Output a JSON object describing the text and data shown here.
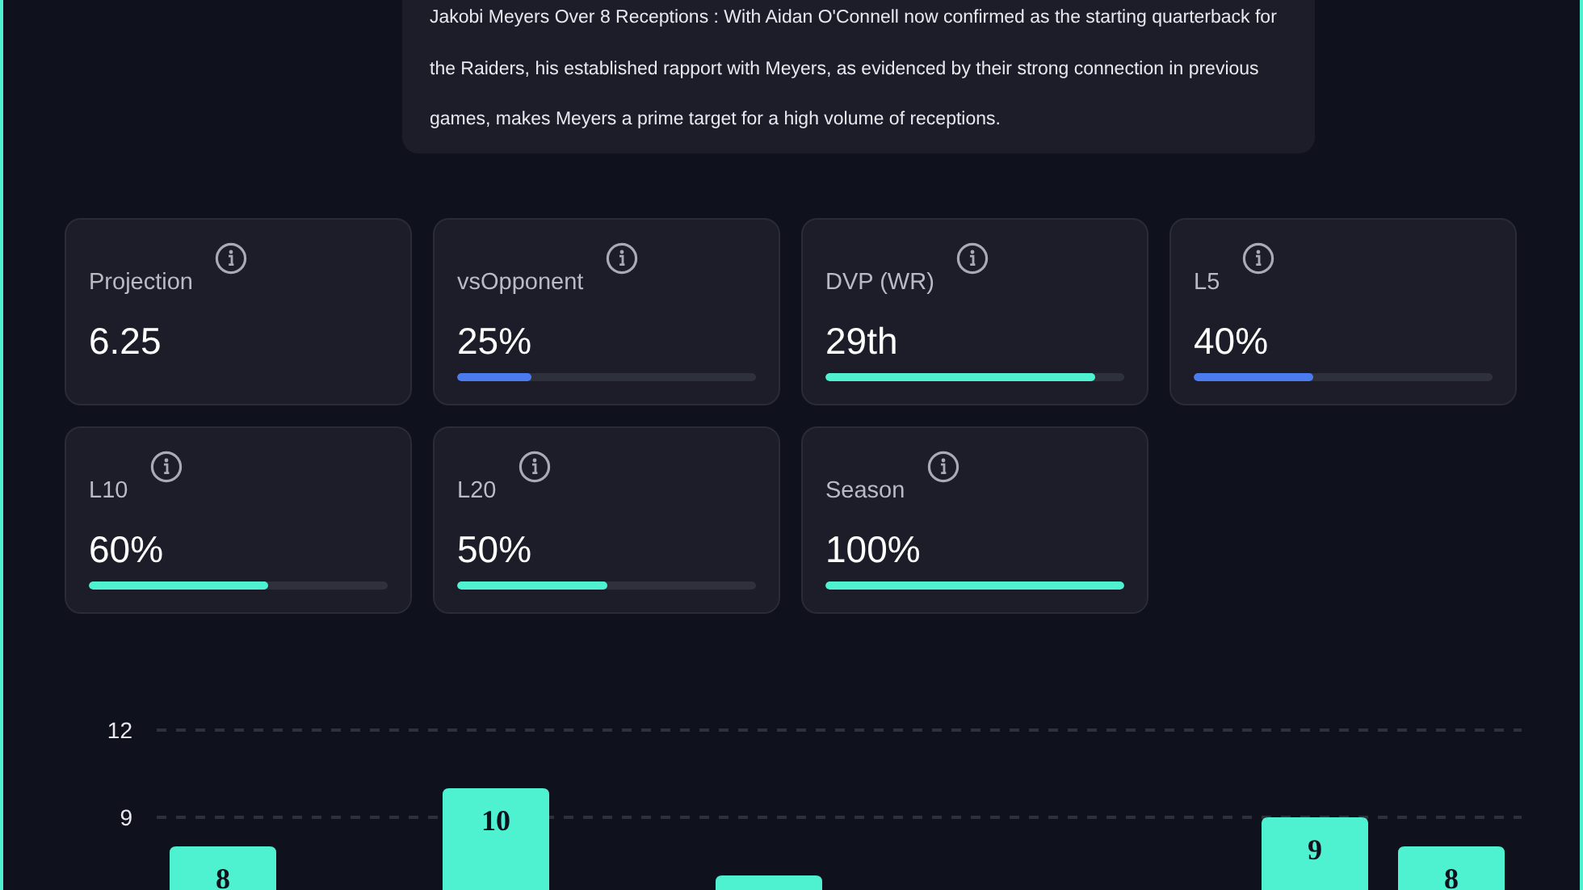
{
  "summary": {
    "text": "Jakobi Meyers Over 8 Receptions : With Aidan O'Connell now confirmed as the starting quarterback for the Raiders, his established rapport with Meyers, as evidenced by their strong connection in previous games, makes Meyers a prime target for a high volume of receptions."
  },
  "stats": [
    {
      "label": "Projection",
      "value": "6.25"
    },
    {
      "label": "vsOpponent",
      "value": "25%",
      "level": 0.25,
      "color": "#4a7cf0"
    },
    {
      "label": "DVP (WR)",
      "value": "29th",
      "level": 0.9,
      "color": "#4ef2d0"
    },
    {
      "label": "L5",
      "value": "40%",
      "level": 0.4,
      "color": "#4a7cf0"
    },
    {
      "label": "L10",
      "value": "60%",
      "level": 0.6,
      "color": "#4ef2d0"
    },
    {
      "label": "L20",
      "value": "50%",
      "level": 0.5,
      "color": "#4ef2d0"
    },
    {
      "label": "Season",
      "value": "100%",
      "level": 1,
      "color": "#4ef2d0"
    }
  ],
  "chart": {
    "chart_data": {
      "type": "bar",
      "series": [
        {
          "color": "#4ef2d0",
          "values": [
            8,
            null,
            10,
            null,
            7,
            null,
            null,
            null,
            9,
            8
          ]
        }
      ],
      "ylim": [
        6.33,
        12
      ],
      "yticks": [
        {
          "value": 9,
          "label": "9"
        },
        {
          "value": 12,
          "label": "12"
        }
      ],
      "value_labels": [
        "8",
        null,
        "10",
        null,
        null,
        null,
        null,
        null,
        "9",
        "8"
      ]
    }
  }
}
